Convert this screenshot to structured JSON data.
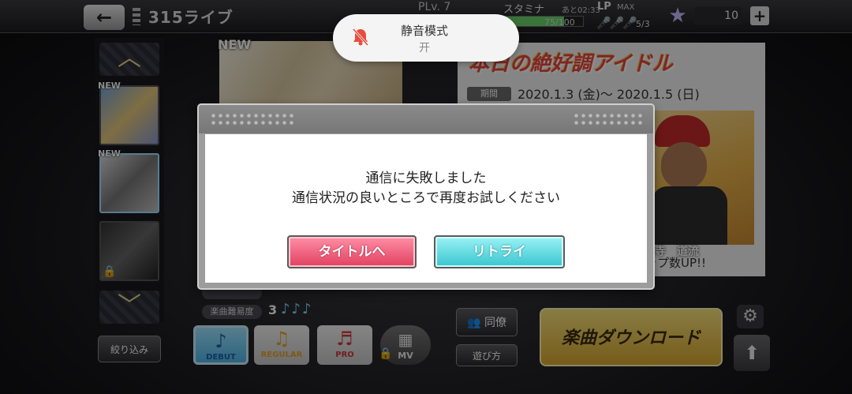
{
  "header": {
    "back_label": "←",
    "title": "315ライブ",
    "player_level": "PLv. 7",
    "stamina_label": "スタミナ",
    "stamina_timer": "あと02:33",
    "stamina_value": "75/100",
    "stamina_fraction": 0.75,
    "lp_label": "LP",
    "lp_max_label": "MAX",
    "lp_value": "5/3",
    "jewel_count": "10",
    "plus_label": "+"
  },
  "sidebar": {
    "new_labels": [
      "NEW",
      "NEW"
    ],
    "filter_label": "絞り込み"
  },
  "song": {
    "album_new": "NEW",
    "difficulty_label": "楽曲難易度",
    "difficulty_value": "3",
    "notes": "♪♪♪",
    "modes": [
      {
        "label": "DEBUT"
      },
      {
        "label": "REGULAR"
      },
      {
        "label": "PRO"
      },
      {
        "label": "MV"
      }
    ]
  },
  "event": {
    "title": "本日の絶好調アイドル",
    "period_label": "期間",
    "period_value": "2020.1.3 (金)〜 2020.1.5 (日)",
    "idol_name": "猿寺　道流",
    "bonus_text": "ップ数UP!!"
  },
  "actions": {
    "unison_label": "同僚",
    "asobi_label": "遊び方",
    "download_label": "楽曲ダウンロード"
  },
  "toast": {
    "title": "静音模式",
    "subtitle": "开"
  },
  "dialog": {
    "line1": "通信に失敗しました",
    "line2": "通信状況の良いところで再度お試しください",
    "to_title_label": "タイトルへ",
    "retry_label": "リトライ"
  }
}
